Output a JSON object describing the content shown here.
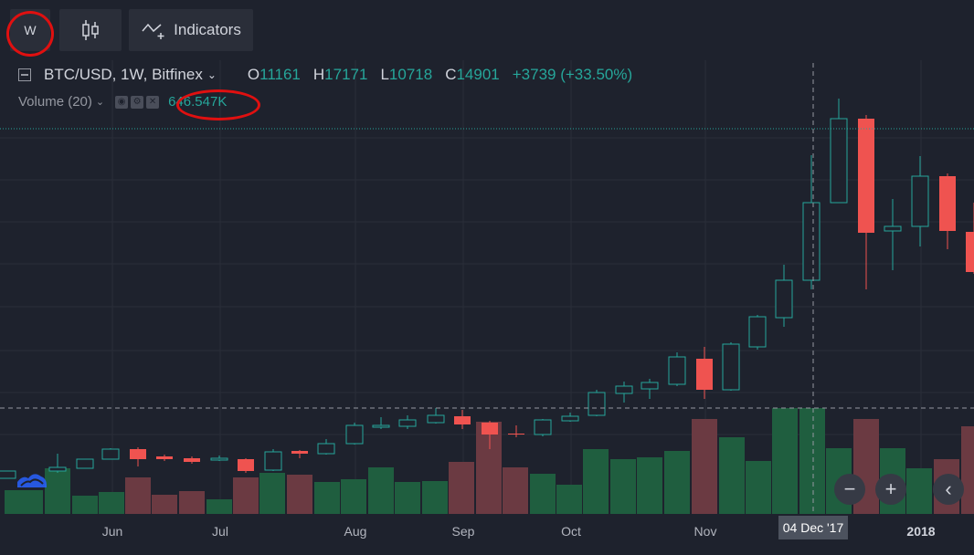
{
  "toolbar": {
    "interval_label": "W",
    "indicators_label": "Indicators"
  },
  "legend": {
    "symbol": "BTC/USD, 1W, Bitfinex",
    "open_key": "O",
    "open": "11161",
    "high_key": "H",
    "high": "17171",
    "low_key": "L",
    "low": "10718",
    "close_key": "C",
    "close": "14901",
    "change": "+3739 (+33.50%)"
  },
  "volume": {
    "label": "Volume (20)",
    "value": "646.547K"
  },
  "xaxis": {
    "labels": [
      "Jun",
      "Jul",
      "Aug",
      "Sep",
      "Oct",
      "Nov"
    ],
    "year_label": "2018",
    "crosshair_date": "04 Dec '17"
  },
  "controls": {
    "zoom_out": "−",
    "zoom_in": "+",
    "scroll_left": "‹"
  },
  "colors": {
    "background": "#1e222d",
    "up": "#26a69a",
    "down": "#ef5350",
    "volume_up": "#1f5e3f",
    "volume_down": "#6b3a42",
    "annotation": "#e01010"
  }
}
